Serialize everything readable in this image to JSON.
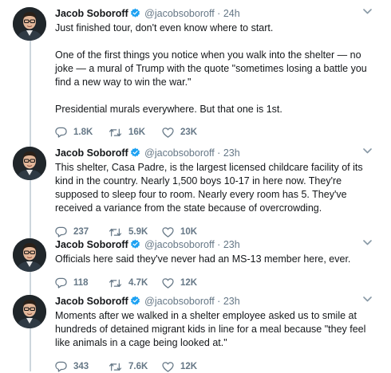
{
  "colors": {
    "secondary": "#657786",
    "text": "#14171a",
    "verified": "#1da1f2",
    "line": "#cdd6dd"
  },
  "tweets": [
    {
      "author": "Jacob Soboroff",
      "handle": "@jacobsoboroff",
      "separator": "·",
      "time": "24h",
      "text": "Just finished tour, don't even know where to start.\n\nOne of the first things you notice when you walk into the shelter — no joke — a mural of Trump with the quote \"sometimes losing a battle you find a new way to win the war.\"\n\nPresidential murals everywhere. But that one is 1st.",
      "replies": "1.8K",
      "retweets": "16K",
      "likes": "23K"
    },
    {
      "author": "Jacob Soboroff",
      "handle": "@jacobsoboroff",
      "separator": "·",
      "time": "23h",
      "text": "This shelter, Casa Padre, is the largest licensed childcare facility of its kind in the country. Nearly 1,500 boys 10-17 in here now. They're supposed to sleep four to room. Nearly every room has 5. They've received a variance from the state because of overcrowding.",
      "replies": "237",
      "retweets": "5.9K",
      "likes": "10K"
    },
    {
      "author": "Jacob Soboroff",
      "handle": "@jacobsoboroff",
      "separator": "·",
      "time": "23h",
      "text": "Officials here said they've never had an MS-13 member here, ever.",
      "replies": "118",
      "retweets": "4.7K",
      "likes": "12K"
    },
    {
      "author": "Jacob Soboroff",
      "handle": "@jacobsoboroff",
      "separator": "·",
      "time": "23h",
      "text": "Moments after we walked in a shelter employee asked us to smile at hundreds of detained migrant kids in line for a meal because \"they feel like animals in a cage being looked at.\"",
      "replies": "343",
      "retweets": "7.6K",
      "likes": "12K"
    }
  ]
}
